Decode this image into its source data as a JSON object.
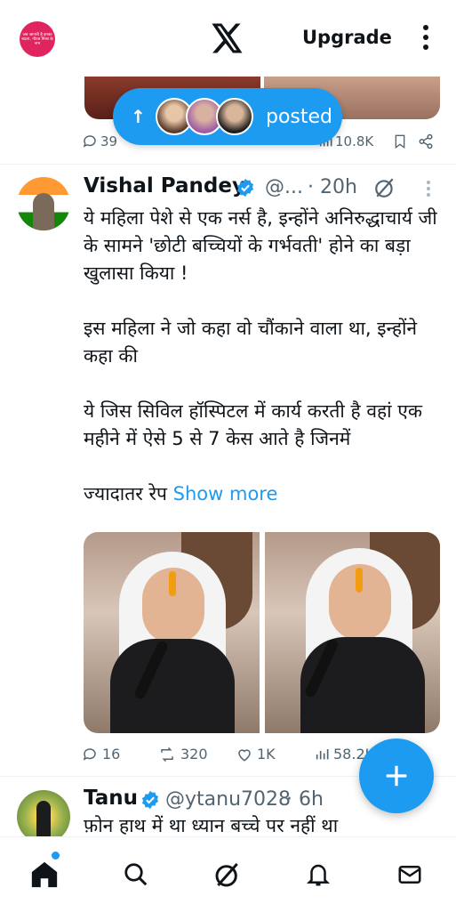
{
  "topbar": {
    "avatar_text": "जब जानारी है इनका बदला, नीरज मिश्रा के नाम",
    "upgrade_label": "Upgrade"
  },
  "banner": {
    "posted_label": "posted",
    "arrow_icon": "arrow-up-icon"
  },
  "prev_tweet": {
    "replies": "39",
    "views": "10.8K"
  },
  "tweet1": {
    "name": "Vishal Pandey",
    "handle": "@...",
    "time": "· 20h",
    "paragraphs": [
      "ये महिला पेशे से एक नर्स है, इन्होंने अनिरुद्धाचार्य जी के सामने 'छोटी बच्चियों के गर्भवती' होने का बड़ा खुलासा किया !",
      "इस महिला ने जो कहा वो चौंकाने वाला था, इन्होंने कहा की",
      "ये जिस सिविल हॉस्पिटल में कार्य करती है वहां एक महीने में ऐसे 5 से 7 केस आते है जिनमें",
      "ज्यादातर रेप "
    ],
    "show_more": "Show more",
    "replies": "16",
    "reposts": "320",
    "likes": "1K",
    "views": "58.2K"
  },
  "tweet2": {
    "name": "Tanu",
    "handle": "@ytanu7028",
    "time": "· 6h",
    "text": "फ़ोन हाथ में था ध्यान बच्चे पर नहीं था"
  },
  "colors": {
    "accent": "#1d9bf0",
    "text": "#0f1419",
    "muted": "#536471"
  },
  "nav": {
    "items": [
      "home-icon",
      "search-icon",
      "grok-icon",
      "notifications-icon",
      "messages-icon"
    ]
  }
}
